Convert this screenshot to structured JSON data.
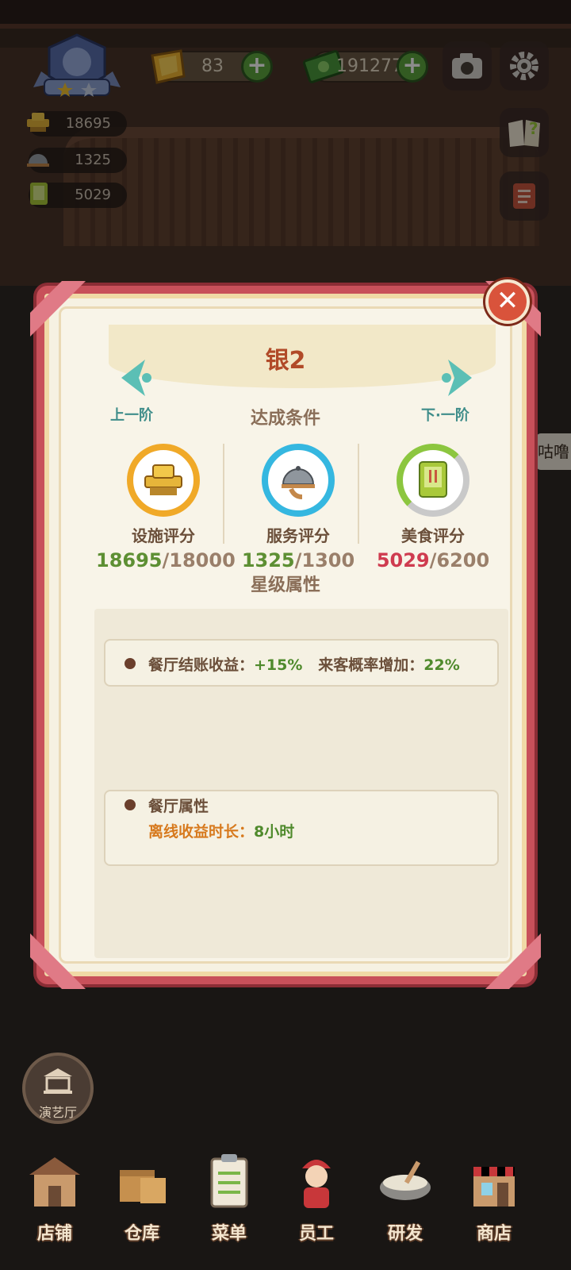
{
  "hud": {
    "gems": "83",
    "cash": "191277",
    "plus": "+",
    "facility_score": "18695",
    "service_score": "1325",
    "food_score": "5029"
  },
  "modal": {
    "title": "银2",
    "prev_label": "上一阶",
    "next_label": "下·一阶",
    "conditions_heading": "达成条件",
    "requirements": [
      {
        "label": "设施评分",
        "current": "18695",
        "sep": "/",
        "need": "18000",
        "met": true,
        "ring_color": "#f0a928",
        "progress": 1.0
      },
      {
        "label": "服务评分",
        "current": "1325",
        "sep": "/",
        "need": "1300",
        "met": true,
        "ring_color": "#35b7e0",
        "progress": 1.0
      },
      {
        "label": "美食评分",
        "current": "5029",
        "sep": "/",
        "need": "6200",
        "met": false,
        "ring_color": "#8cc63f",
        "progress": 0.81
      }
    ],
    "attributes_heading": "星级属性",
    "star_attr": {
      "label1": "餐厅结账收益：",
      "value1": "+15%",
      "label2": "来客概率增加：",
      "value2": "22%"
    },
    "restaurant_attr": {
      "title": "餐厅属性",
      "label": "离线收益时长：",
      "value": "8小时"
    },
    "close": "✕"
  },
  "side_tag": "咕噜",
  "theater_label": "演艺厅",
  "nav": [
    {
      "label": "店铺",
      "icon": "shop-icon"
    },
    {
      "label": "仓库",
      "icon": "warehouse-icon"
    },
    {
      "label": "菜单",
      "icon": "menu-clipboard-icon"
    },
    {
      "label": "员工",
      "icon": "staff-icon"
    },
    {
      "label": "研发",
      "icon": "research-pot-icon"
    },
    {
      "label": "商店",
      "icon": "store-icon"
    }
  ],
  "colors": {
    "modal_border": "#c8505a",
    "title": "#b14a28",
    "arrow": "#5bbfb5",
    "met": "#5d8f33",
    "unmet": "#cf3b4f"
  }
}
